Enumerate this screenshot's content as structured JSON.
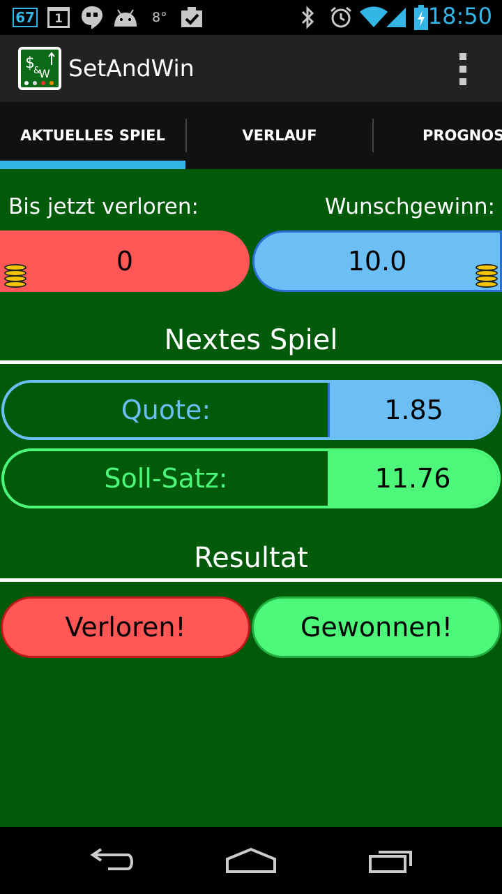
{
  "status_bar": {
    "notif_count": "67",
    "calendar_day": "1",
    "temperature": "8°",
    "time": "18:50",
    "icons": [
      "notification-67-icon",
      "calendar-icon",
      "hangouts-icon",
      "android-icon",
      "weather-icon",
      "clipboard-check-icon",
      "bluetooth-icon",
      "alarm-icon",
      "wifi-icon",
      "signal-icon",
      "battery-charging-icon"
    ]
  },
  "action_bar": {
    "title": "SetAndWin",
    "app_icon": "app-logo-icon",
    "overflow_icon": "overflow-menu-icon"
  },
  "tabs": [
    {
      "label": "AKTUELLES SPIEL",
      "selected": true
    },
    {
      "label": "VERLAUF",
      "selected": false
    },
    {
      "label": "PROGNOS",
      "selected": false
    }
  ],
  "colors": {
    "background": "#005a0a",
    "accent": "#33b5e5",
    "lost_red": "#ff5656",
    "blue": "#6cbff5",
    "green": "#4df77a"
  },
  "current_game": {
    "lost_label": "Bis jetzt verloren:",
    "lost_value": "0",
    "wish_label": "Wunschgewinn:",
    "wish_value": "10.0",
    "next_title": "Nextes Spiel",
    "quote_label": "Quote:",
    "quote_value": "1.85",
    "stake_label": "Soll-Satz:",
    "stake_value": "11.76",
    "result_title": "Resultat",
    "lost_button": "Verloren!",
    "won_button": "Gewonnen!"
  },
  "nav_bar": {
    "icons": [
      "back-icon",
      "home-icon",
      "recent-apps-icon"
    ]
  }
}
